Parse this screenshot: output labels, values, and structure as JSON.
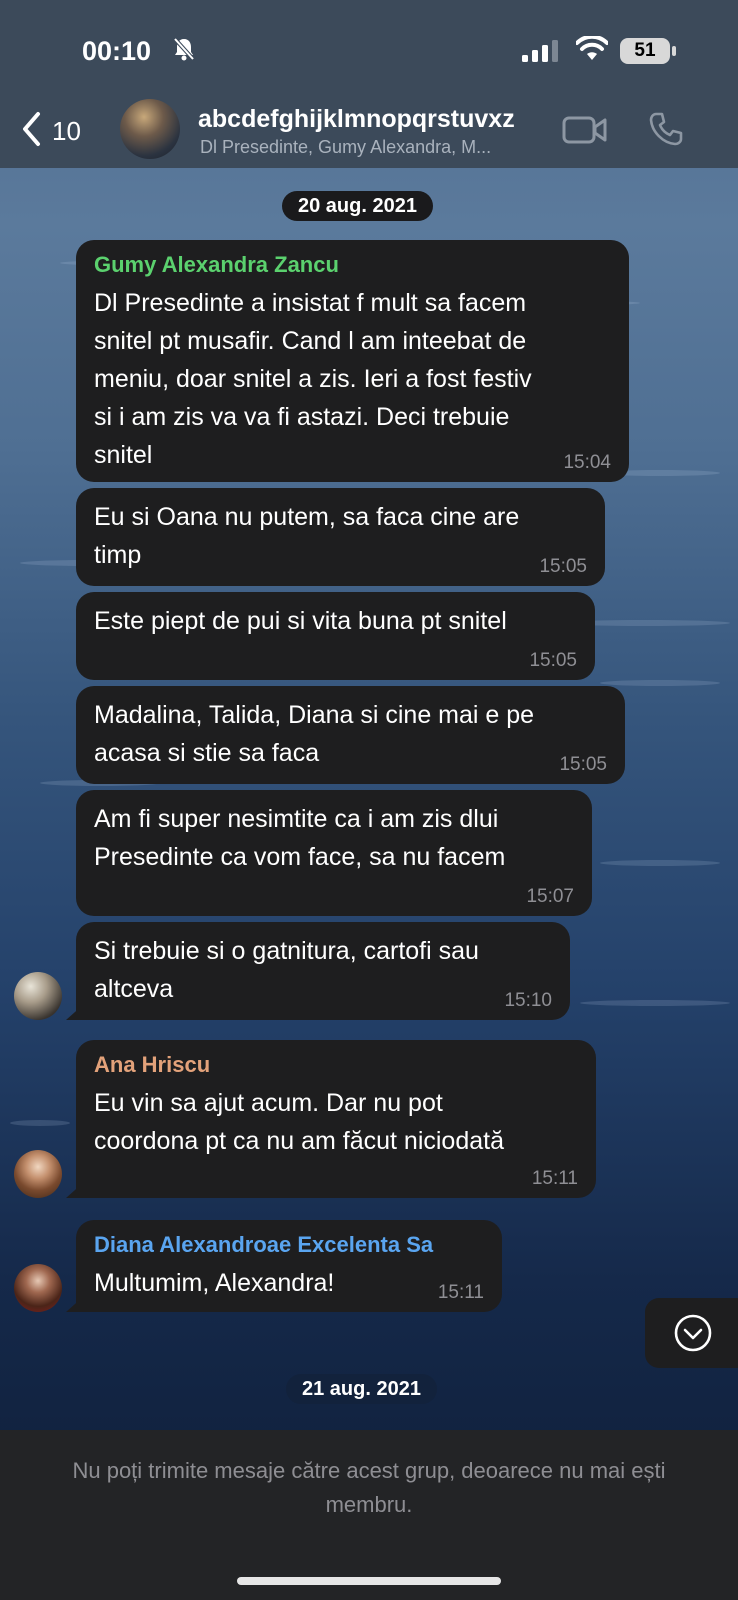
{
  "status_bar": {
    "time": "00:10",
    "battery": "51"
  },
  "header": {
    "back_count": "10",
    "title": "abcdefghijklmnopqrstuvxz",
    "subtitle": "Dl Presedinte, Gumy Alexandra, M..."
  },
  "chat": {
    "date_1": "20 aug. 2021",
    "date_2": "21 aug. 2021",
    "messages": [
      {
        "sender": "Gumy Alexandra Zancu",
        "text": "Dl Presedinte a insistat f mult sa facem\nsnitel pt musafir. Cand l am inteebat de\nmeniu, doar snitel a zis. Ieri a fost festiv\nsi i am zis va va fi astazi. Deci trebuie\nsnitel",
        "time": "15:04"
      },
      {
        "text": "Eu si Oana nu putem, sa faca cine are\ntimp",
        "time": "15:05"
      },
      {
        "text": "Este piept de pui si vita buna pt snitel",
        "time": "15:05"
      },
      {
        "text": "Madalina, Talida, Diana si cine mai e pe\nacasa si stie sa faca",
        "time": "15:05"
      },
      {
        "text": "Am fi super nesimtite ca i am zis dlui\nPresedinte ca vom face, sa nu facem",
        "time": "15:07"
      },
      {
        "text": "Si trebuie si o gatnitura, cartofi sau\naltceva",
        "time": "15:10"
      },
      {
        "sender": "Ana Hriscu",
        "text": "Eu vin sa ajut acum. Dar nu pot\ncoordona pt ca nu am făcut niciodată",
        "time": "15:11"
      },
      {
        "sender": "Diana Alexandroae Excelenta Sa",
        "text": "Multumim, Alexandra!",
        "time": "15:11"
      }
    ]
  },
  "footer": {
    "notice": "Nu poți trimite mesaje către acest grup, deoarece nu mai ești membru."
  },
  "colors": {
    "sender_1": "#5bd16e",
    "sender_2": "#e3a27a",
    "sender_3": "#5aa5f0",
    "bubble": "#1e1e1f",
    "header": "#3c4a5a"
  },
  "icons": [
    "bell-slash-icon",
    "signal-icon",
    "wifi-icon",
    "back-chevron-icon",
    "video-call-icon",
    "phone-call-icon",
    "scroll-down-icon"
  ]
}
